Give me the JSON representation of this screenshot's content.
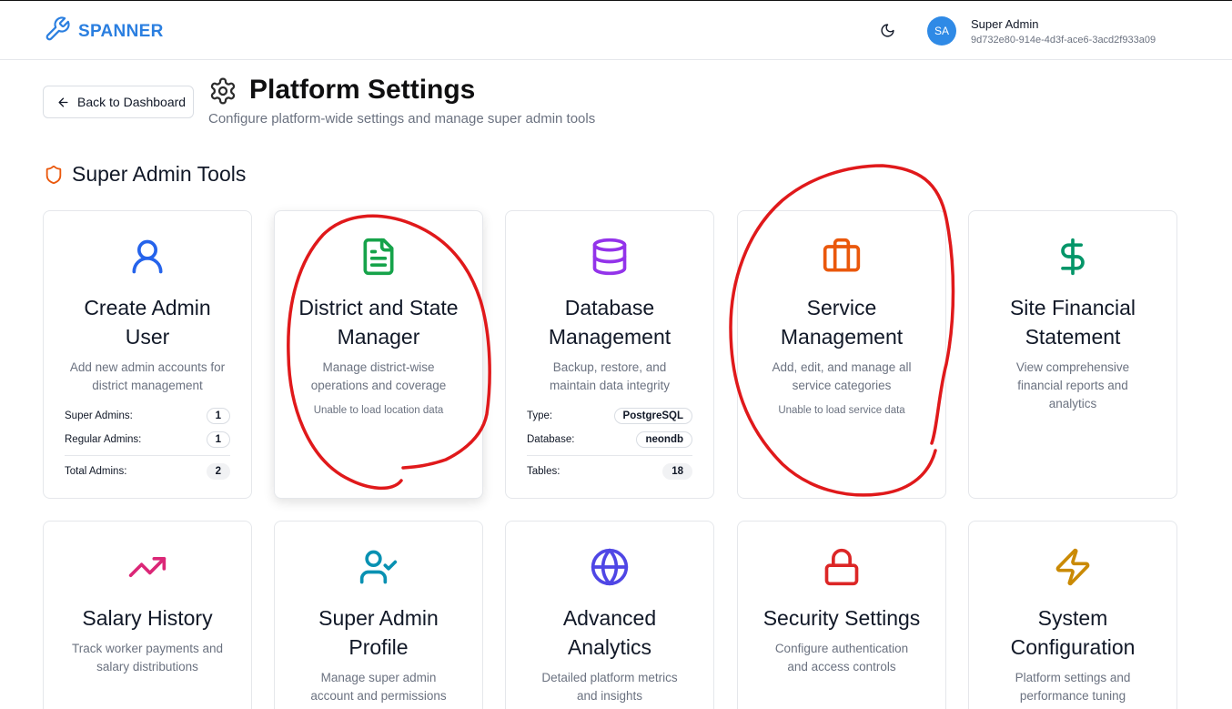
{
  "header": {
    "brand": "SPANNER",
    "user": {
      "initials": "SA",
      "name": "Super Admin",
      "id": "9d732e80-914e-4d3f-ace6-3acd2f933a09"
    }
  },
  "page": {
    "back_label": "Back to Dashboard",
    "title": "Platform Settings",
    "subtitle": "Configure platform-wide settings and manage super admin tools"
  },
  "section": {
    "title": "Super Admin Tools"
  },
  "cards": {
    "create_admin": {
      "title_line1": "Create Admin",
      "title_line2": "User",
      "desc_line1": "Add new admin accounts for",
      "desc_line2": "district management",
      "stats": [
        {
          "label": "Super Admins:",
          "value": "1"
        },
        {
          "label": "Regular Admins:",
          "value": "1"
        },
        {
          "label": "Total Admins:",
          "value": "2"
        }
      ]
    },
    "district": {
      "title_line1": "District and State",
      "title_line2": "Manager",
      "desc_line1": "Manage district-wise",
      "desc_line2": "operations and coverage",
      "note": "Unable to load location data"
    },
    "database": {
      "title_line1": "Database",
      "title_line2": "Management",
      "desc_line1": "Backup, restore, and",
      "desc_line2": "maintain data integrity",
      "stats": [
        {
          "label": "Type:",
          "value": "PostgreSQL"
        },
        {
          "label": "Database:",
          "value": "neondb"
        },
        {
          "label": "Tables:",
          "value": "18"
        }
      ]
    },
    "service": {
      "title_line1": "Service",
      "title_line2": "Management",
      "desc_line1": "Add, edit, and manage all",
      "desc_line2": "service categories",
      "note": "Unable to load service data"
    },
    "financial": {
      "title_line1": "Site Financial",
      "title_line2": "Statement",
      "desc_line1": "View comprehensive",
      "desc_line2": "financial reports and",
      "desc_line3": "analytics"
    },
    "salary": {
      "title_line1": "Salary History",
      "desc_line1": "Track worker payments and",
      "desc_line2": "salary distributions"
    },
    "profile": {
      "title_line1": "Super Admin",
      "title_line2": "Profile",
      "desc_line1": "Manage super admin",
      "desc_line2": "account and permissions"
    },
    "analytics": {
      "title_line1": "Advanced",
      "title_line2": "Analytics",
      "desc_line1": "Detailed platform metrics",
      "desc_line2": "and insights"
    },
    "security": {
      "title_line1": "Security Settings",
      "desc_line1": "Configure authentication",
      "desc_line2": "and access controls"
    },
    "system": {
      "title_line1": "System",
      "title_line2": "Configuration",
      "desc_line1": "Platform settings and",
      "desc_line2": "performance tuning"
    }
  },
  "colors": {
    "brand": "#2b7fe0",
    "annotation": "#e0191b",
    "blue": "#2563eb",
    "green": "#16a34a",
    "purple": "#9333ea",
    "orange": "#ea580c",
    "teal": "#059669",
    "pink": "#db2777",
    "cyan": "#0891b2",
    "indigo": "#4f46e5",
    "red": "#dc2626",
    "amber": "#ca8a04"
  }
}
